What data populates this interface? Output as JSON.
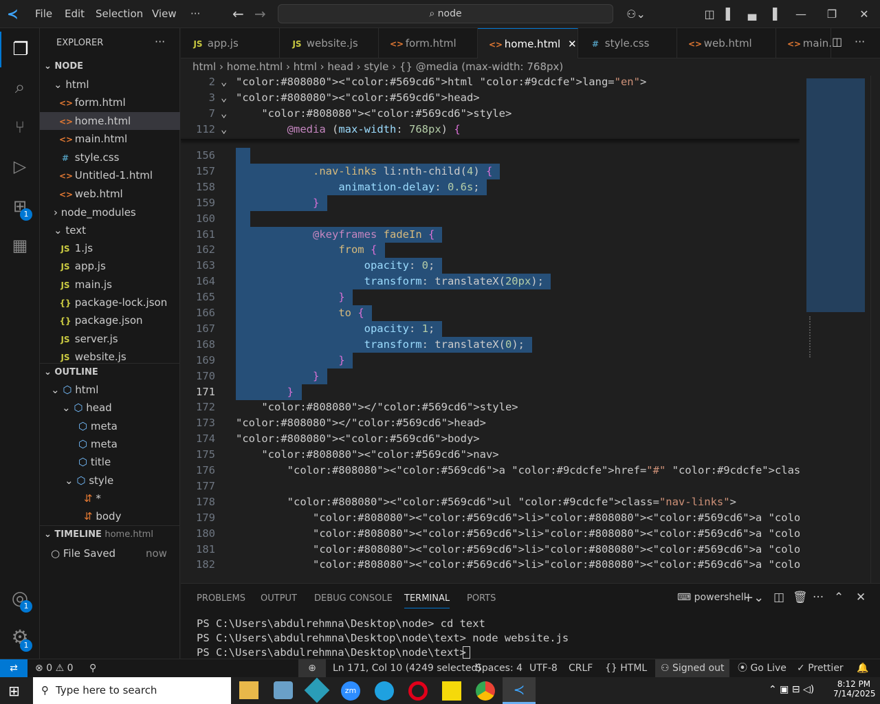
{
  "menu": {
    "file": "File",
    "edit": "Edit",
    "selection": "Selection",
    "view": "View",
    "more": "···"
  },
  "search": {
    "text": "node"
  },
  "tabs": [
    {
      "type": "JS",
      "label": "app.js"
    },
    {
      "type": "JS",
      "label": "website.js"
    },
    {
      "type": "<>",
      "label": "form.html"
    },
    {
      "type": "<>",
      "label": "home.html"
    },
    {
      "type": "#",
      "label": "style.css"
    },
    {
      "type": "<>",
      "label": "web.html"
    },
    {
      "type": "<>",
      "label": "main."
    }
  ],
  "sidebar": {
    "title": "EXPLORER",
    "node": "NODE",
    "html": "html",
    "files_html": [
      "form.html",
      "home.html",
      "main.html",
      "style.css",
      "Untitled-1.html",
      "web.html"
    ],
    "node_modules": "node_modules",
    "text": "text",
    "files_text": [
      {
        "t": "JS",
        "n": "1.js"
      },
      {
        "t": "JS",
        "n": "app.js"
      },
      {
        "t": "JS",
        "n": "main.js"
      },
      {
        "t": "{}",
        "n": "package-lock.json"
      },
      {
        "t": "{}",
        "n": "package.json"
      },
      {
        "t": "JS",
        "n": "server.js"
      },
      {
        "t": "JS",
        "n": "website.js"
      }
    ],
    "outline": "OUTLINE",
    "outline_items": [
      "html",
      "head",
      "meta",
      "meta",
      "title",
      "style",
      "*",
      "body"
    ],
    "timeline": "TIMELINE",
    "timeline_file": "home.html",
    "timeline_entry": "File Saved",
    "timeline_time": "now"
  },
  "breadcrumb": [
    "html",
    "home.html",
    "html",
    "head",
    "style",
    "{} @media (max-width: 768px)"
  ],
  "sticky": [
    {
      "n": "2",
      "c": "<html lang=\"en\">"
    },
    {
      "n": "3",
      "c": "<head>"
    },
    {
      "n": "7",
      "c": "    <style>"
    },
    {
      "n": "112",
      "c": "        @media (max-width: 768px) {"
    }
  ],
  "code": [
    {
      "n": "156",
      "c": "",
      "s": true
    },
    {
      "n": "157",
      "c": "            .nav-links li:nth-child(4) {",
      "s": true
    },
    {
      "n": "158",
      "c": "                animation-delay: 0.6s;",
      "s": true
    },
    {
      "n": "159",
      "c": "            }",
      "s": true
    },
    {
      "n": "160",
      "c": "",
      "s": true
    },
    {
      "n": "161",
      "c": "            @keyframes fadeIn {",
      "s": true
    },
    {
      "n": "162",
      "c": "                from {",
      "s": true
    },
    {
      "n": "163",
      "c": "                    opacity: 0;",
      "s": true
    },
    {
      "n": "164",
      "c": "                    transform: translateX(20px);",
      "s": true
    },
    {
      "n": "165",
      "c": "                }",
      "s": true
    },
    {
      "n": "166",
      "c": "                to {",
      "s": true
    },
    {
      "n": "167",
      "c": "                    opacity: 1;",
      "s": true
    },
    {
      "n": "168",
      "c": "                    transform: translateX(0);",
      "s": true
    },
    {
      "n": "169",
      "c": "                }",
      "s": true
    },
    {
      "n": "170",
      "c": "            }",
      "s": true
    },
    {
      "n": "171",
      "c": "        }",
      "s": true
    },
    {
      "n": "172",
      "c": "    </style>",
      "s": false
    },
    {
      "n": "173",
      "c": "</head>",
      "s": false
    },
    {
      "n": "174",
      "c": "<body>",
      "s": false
    },
    {
      "n": "175",
      "c": "    <nav>",
      "s": false
    },
    {
      "n": "176",
      "c": "        <a href=\"#\" class=\"logo\">AnimatedNav</a>",
      "s": false
    },
    {
      "n": "177",
      "c": "",
      "s": false
    },
    {
      "n": "178",
      "c": "        <ul class=\"nav-links\">",
      "s": false
    },
    {
      "n": "179",
      "c": "            <li><a href=\"#\">Home</a></li>",
      "s": false
    },
    {
      "n": "180",
      "c": "            <li><a href=\"#\">About</a></li>",
      "s": false
    },
    {
      "n": "181",
      "c": "            <li><a href=\"#\">Services</a></li>",
      "s": false
    },
    {
      "n": "182",
      "c": "            <li><a href=\"#\">Contact</a></li>",
      "s": false
    }
  ],
  "panel": {
    "tabs": [
      "PROBLEMS",
      "OUTPUT",
      "DEBUG CONSOLE",
      "TERMINAL",
      "PORTS"
    ],
    "shell": "powershell",
    "lines": [
      "PS C:\\Users\\abdulrehmna\\Desktop\\node> cd text",
      "PS C:\\Users\\abdulrehmna\\Desktop\\node\\text> node website.js",
      "PS C:\\Users\\abdulrehmna\\Desktop\\node\\text> "
    ]
  },
  "status": {
    "errors": "0",
    "warnings": "0",
    "position": "Ln 171, Col 10 (4249 selected)",
    "spaces": "Spaces: 4",
    "encoding": "UTF-8",
    "eol": "CRLF",
    "lang": "HTML",
    "signed": "Signed out",
    "golive": "Go Live",
    "prettier": "Prettier"
  },
  "taskbar": {
    "search": "Type here to search",
    "time": "8:12 PM",
    "date": "7/14/2025"
  },
  "badges": {
    "extensions": "1",
    "accounts": "1",
    "settings": "1"
  }
}
